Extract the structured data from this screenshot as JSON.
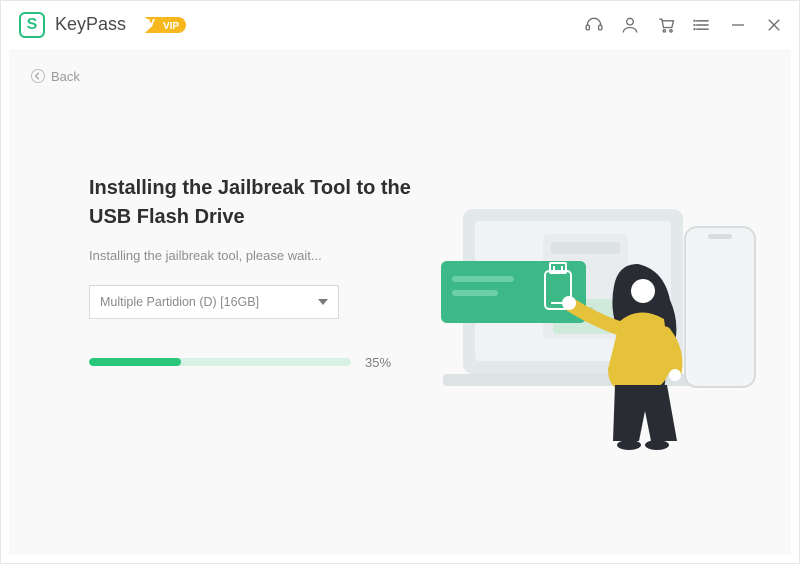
{
  "app": {
    "name": "KeyPass",
    "logo_letter": "S",
    "vip_label": "VIP"
  },
  "nav": {
    "back_label": "Back"
  },
  "main": {
    "heading": "Installing the Jailbreak Tool to the USB Flash Drive",
    "subtext": "Installing the jailbreak tool, please wait...",
    "dropdown_value": "Multiple Partidion (D) [16GB]",
    "progress_pct": 35,
    "progress_label": "35%"
  },
  "colors": {
    "accent": "#28c77b",
    "vip": "#f6b81e"
  }
}
